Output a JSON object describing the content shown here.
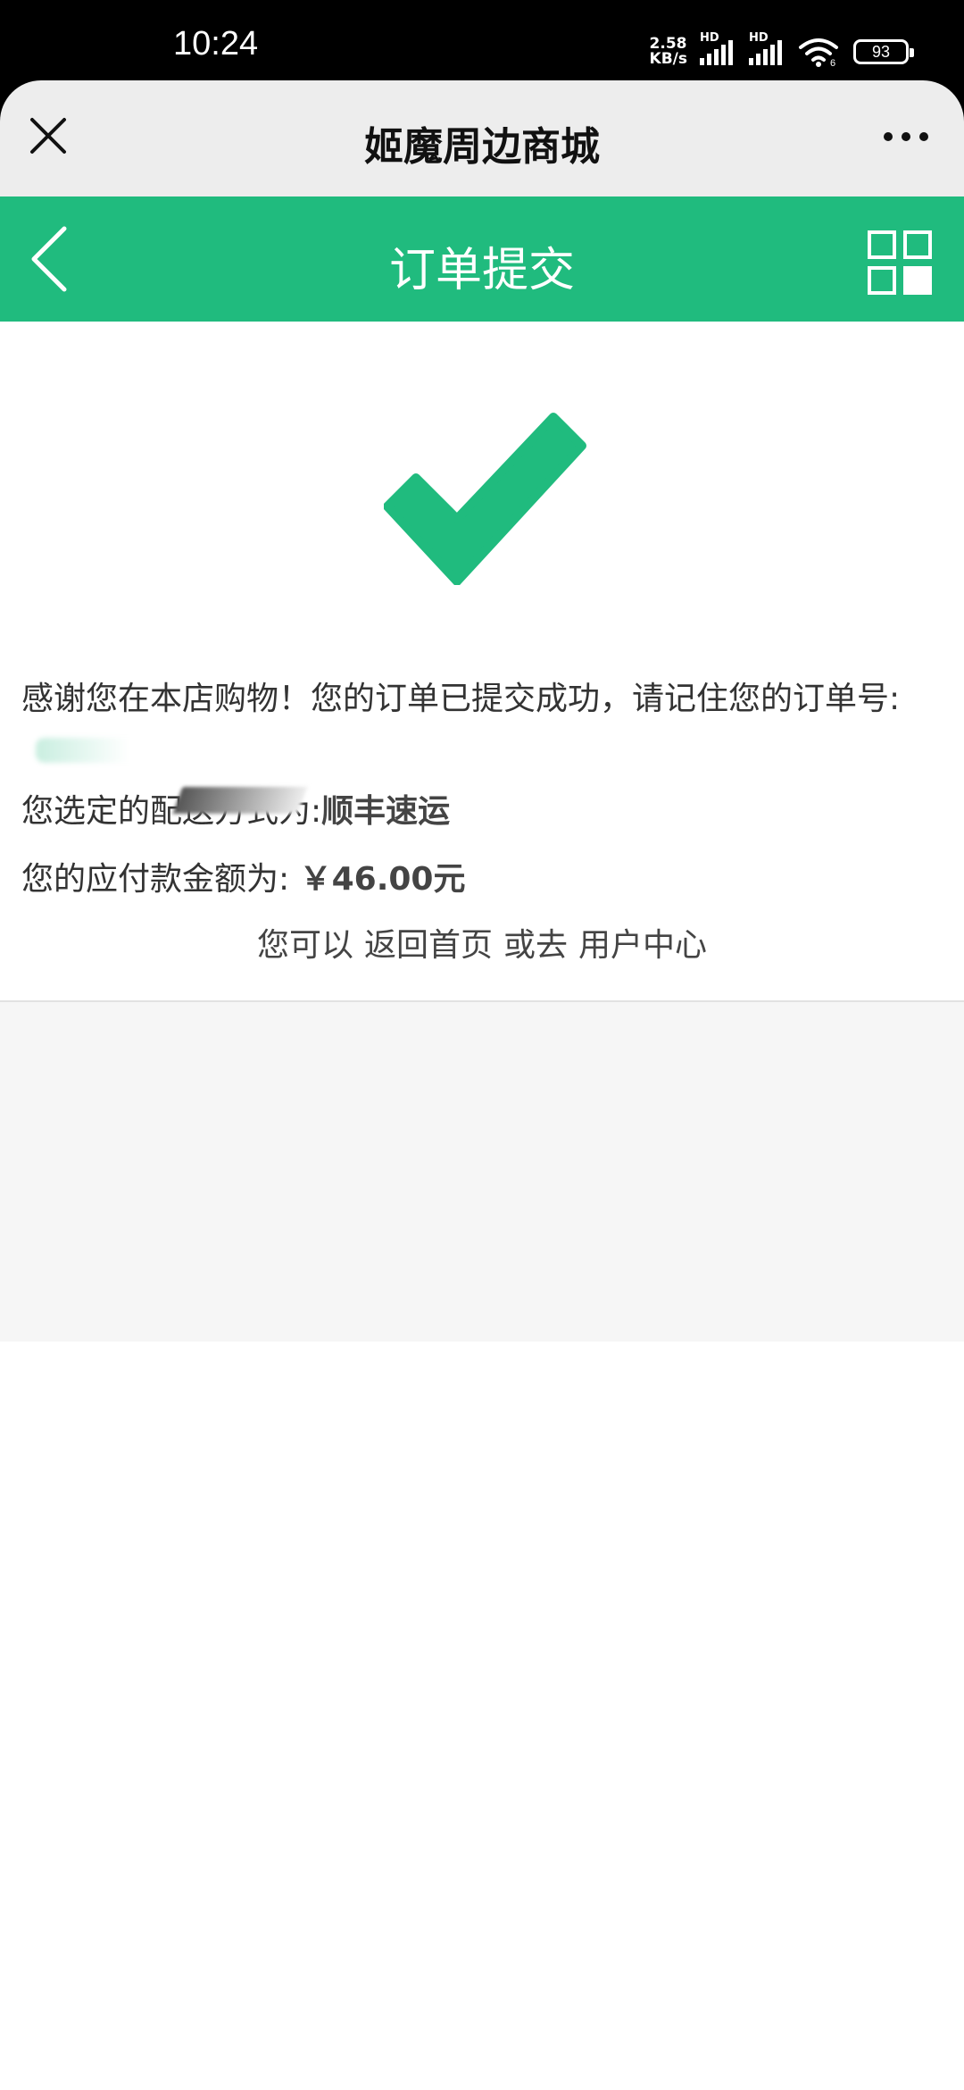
{
  "status_bar": {
    "time": "10:24",
    "net_speed_value": "2.58",
    "net_speed_unit": "KB/s",
    "signal_1_label": "HD",
    "signal_2_label": "HD",
    "wifi_sub": "6",
    "battery": "93"
  },
  "window": {
    "title": "姬魔周边商城",
    "close_icon": "close-icon",
    "more_icon": "more-icon"
  },
  "header": {
    "title": "订单提交",
    "back_icon": "back-icon",
    "grid_icon": "grid-icon",
    "accent_color": "#20bb7e"
  },
  "success": {
    "icon": "check-icon",
    "message": "感谢您在本店购物！您的订单已提交成功，请记住您的订单号:",
    "shipping_label": "您选定的配送方式为:",
    "shipping_method": "顺丰速运",
    "amount_label": "您的应付款金额为:",
    "amount_value": "￥46.00元",
    "links_prefix": "您可以",
    "home_link": "返回首页",
    "links_middle": "或去",
    "user_center_link": "用户中心"
  }
}
